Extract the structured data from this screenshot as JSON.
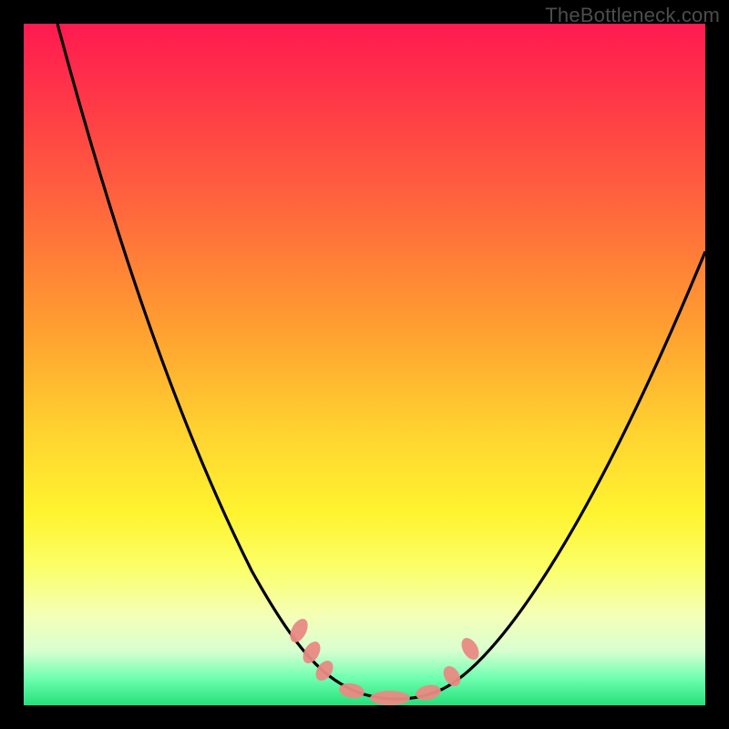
{
  "watermark": "TheBottleneck.com",
  "chart_data": {
    "type": "line",
    "title": "",
    "xlabel": "",
    "ylabel": "",
    "xlim": [
      0,
      100
    ],
    "ylim": [
      0,
      100
    ],
    "grid": false,
    "legend": false,
    "background_gradient": {
      "direction": "vertical",
      "stops": [
        {
          "pos": 0,
          "color": "#ff1a50"
        },
        {
          "pos": 50,
          "color": "#ffb830"
        },
        {
          "pos": 78,
          "color": "#fff430"
        },
        {
          "pos": 100,
          "color": "#24e07a"
        }
      ]
    },
    "series": [
      {
        "name": "bottleneck-curve",
        "color": "#000000",
        "x": [
          5,
          10,
          15,
          20,
          25,
          30,
          35,
          40,
          44,
          48,
          52,
          56,
          60,
          65,
          70,
          75,
          80,
          85,
          90,
          95,
          100
        ],
        "y": [
          100,
          85,
          72,
          59,
          47,
          36,
          26,
          17,
          10,
          4,
          1,
          1,
          3,
          8,
          15,
          24,
          34,
          44,
          53,
          61,
          68
        ]
      }
    ],
    "markers": [
      {
        "name": "left-upper-pill",
        "x": 41,
        "y": 12,
        "color": "#e57373"
      },
      {
        "name": "left-mid-pill",
        "x": 43,
        "y": 8,
        "color": "#e57373"
      },
      {
        "name": "left-low-pill",
        "x": 45,
        "y": 5,
        "color": "#e57373"
      },
      {
        "name": "valley-left-pill",
        "x": 48,
        "y": 2,
        "color": "#e57373"
      },
      {
        "name": "valley-mid-pill",
        "x": 53,
        "y": 1,
        "color": "#e57373"
      },
      {
        "name": "valley-right-pill",
        "x": 58,
        "y": 2,
        "color": "#e57373"
      },
      {
        "name": "right-low-pill",
        "x": 61,
        "y": 5,
        "color": "#e57373"
      },
      {
        "name": "right-upper-pill",
        "x": 64,
        "y": 10,
        "color": "#e57373"
      }
    ]
  }
}
